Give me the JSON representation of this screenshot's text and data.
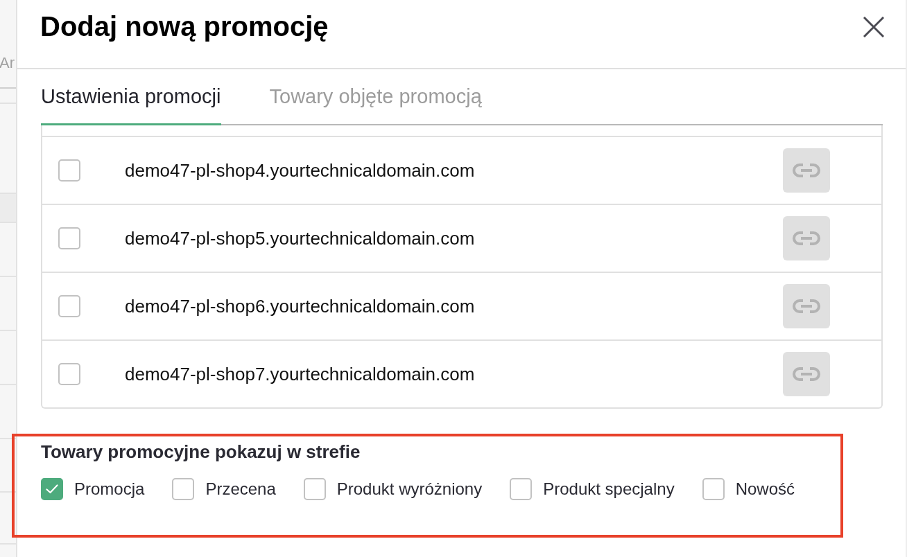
{
  "background_page": {
    "partial_text": "Ar"
  },
  "dialog": {
    "title": "Dodaj nową promocję"
  },
  "tabs": [
    {
      "label": "Ustawienia promocji",
      "selected": true
    },
    {
      "label": "Towary objęte promocją",
      "selected": false
    }
  ],
  "domains": [
    {
      "name": "demo47-pl-shop4.yourtechnicaldomain.com",
      "checked": false
    },
    {
      "name": "demo47-pl-shop5.yourtechnicaldomain.com",
      "checked": false
    },
    {
      "name": "demo47-pl-shop6.yourtechnicaldomain.com",
      "checked": false
    },
    {
      "name": "demo47-pl-shop7.yourtechnicaldomain.com",
      "checked": false
    }
  ],
  "display_zones": {
    "heading": "Towary promocyjne pokazuj w strefie",
    "highlighted": true,
    "options": [
      {
        "label": "Promocja",
        "checked": true
      },
      {
        "label": "Przecena",
        "checked": false
      },
      {
        "label": "Produkt wyróżniony",
        "checked": false
      },
      {
        "label": "Produkt specjalny",
        "checked": false
      },
      {
        "label": "Nowość",
        "checked": false
      }
    ]
  }
}
